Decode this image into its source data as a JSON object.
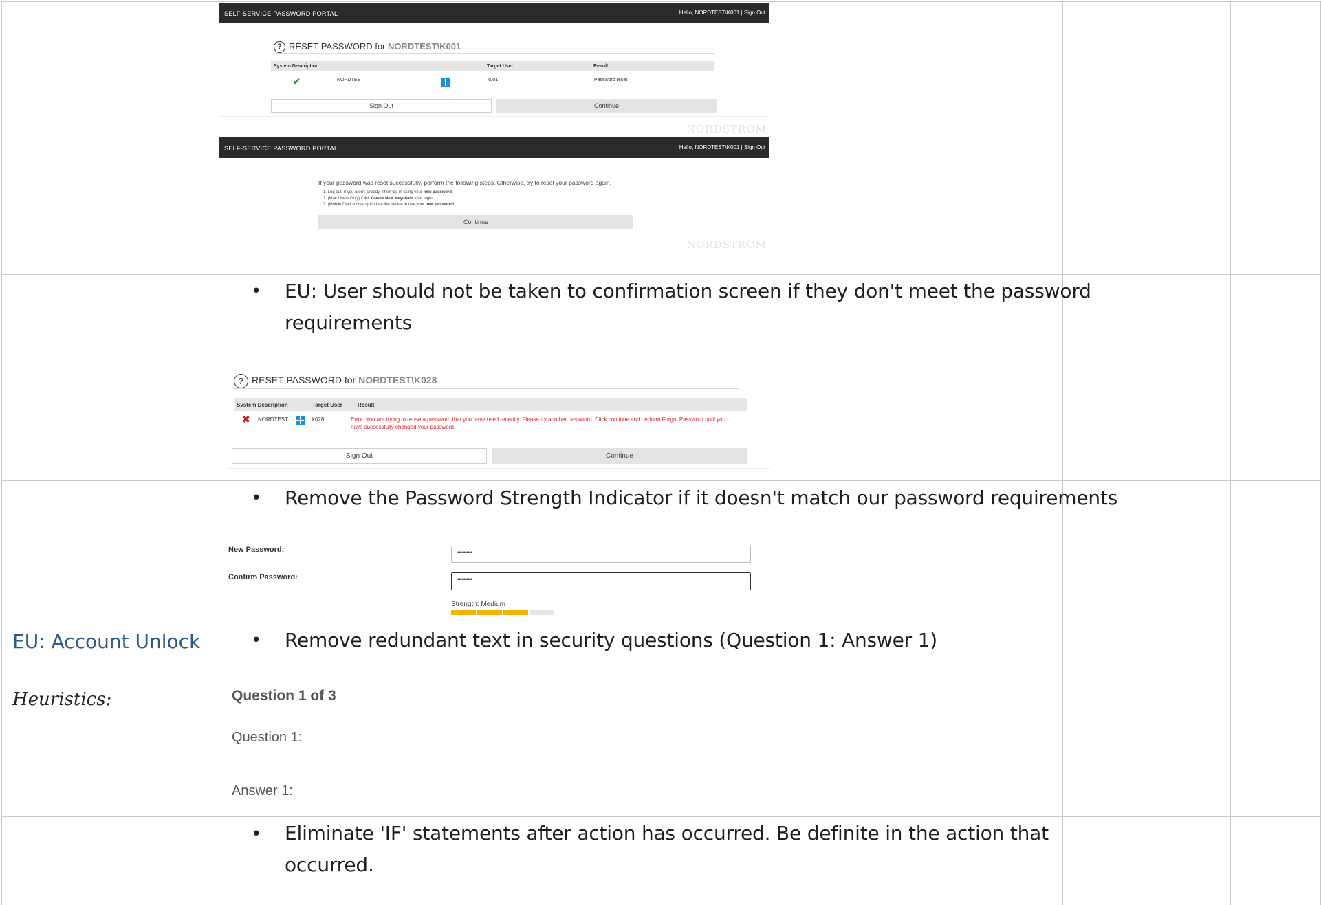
{
  "row1": {
    "portal1": {
      "portal_title": "SELF-SERVICE PASSWORD PORTAL",
      "greeting": "Hello, NORDTEST\\K001 | Sign Out",
      "reset_title_prefix": "RESET PASSWORD for",
      "reset_title_user": "NORDTEST\\K001",
      "col_system": "System Description",
      "col_target": "Target User",
      "col_result": "Result",
      "system": "NORDTEST",
      "target": "k001",
      "result": "Password reset",
      "sign_out": "Sign Out",
      "continue": "Continue",
      "brand": "NORDSTROM"
    },
    "portal2": {
      "portal_title": "SELF-SERVICE PASSWORD PORTAL",
      "greeting": "Hello, NORDTEST\\K001 | Sign Out",
      "intro": "If your password was reset successfully, perform the following steps. Otherwise, try to reset your password again.",
      "step1_a": "1.  Log out, if you aren't already. Then log in using your ",
      "step1_b": "new password",
      "step1_c": ".",
      "step2_a": "2.  (Mac Users Only) Click ",
      "step2_b": "Create New Keychain",
      "step2_c": " after login.",
      "step3_a": "3.  (Mobile Device Users) Update the device to use your ",
      "step3_b": "new password",
      "step3_c": ".",
      "continue": "Continue",
      "brand": "NORDSTROM"
    }
  },
  "row2": {
    "bullet_line1": "EU: User should not be taken to confirmation screen if they don't meet the password",
    "bullet_line2": "requirements",
    "reset_title_prefix": "RESET PASSWORD for",
    "reset_title_user": "NORDTEST\\K028",
    "col_system": "System Description",
    "col_target": "Target User",
    "col_result": "Result",
    "system": "NORDTEST",
    "target": "k028",
    "error_line1": "Error: You are trying to reuse a password that you have used recently. Please try another password. Click continue and perform Forgot Password until you",
    "error_line2": "have successfully changed your password.",
    "sign_out": "Sign Out",
    "continue": "Continue"
  },
  "row3": {
    "bullet": "Remove the Password Strength Indicator if it doesn't match our password requirements",
    "new_password_label": "New Password:",
    "confirm_password_label": "Confirm Password:",
    "new_password_value": "••••••••••",
    "confirm_password_value": "••••••••••",
    "strength_label": "Strength: Medium",
    "strength_level": 0.75,
    "strength_color": "#f5b400"
  },
  "row4": {
    "left_heading": "EU: Account Unlock",
    "left_italic": "Heuristics:",
    "bullet": "Remove redundant text in security questions (Question 1: Answer 1)",
    "question_header": "Question 1 of 3",
    "question_label": "Question 1:",
    "answer_label": "Answer 1:"
  },
  "row5": {
    "bullet_line1": "Eliminate 'IF' statements after action has occurred. Be definite in the action that",
    "bullet_line2": "occurred."
  },
  "colors": {
    "grid": "#c8c8c8",
    "heading_blue": "#2c5a8a",
    "portal_bar": "#2b2b2b",
    "error_red": "#e8262b",
    "success_green": "#1a9a3a"
  }
}
